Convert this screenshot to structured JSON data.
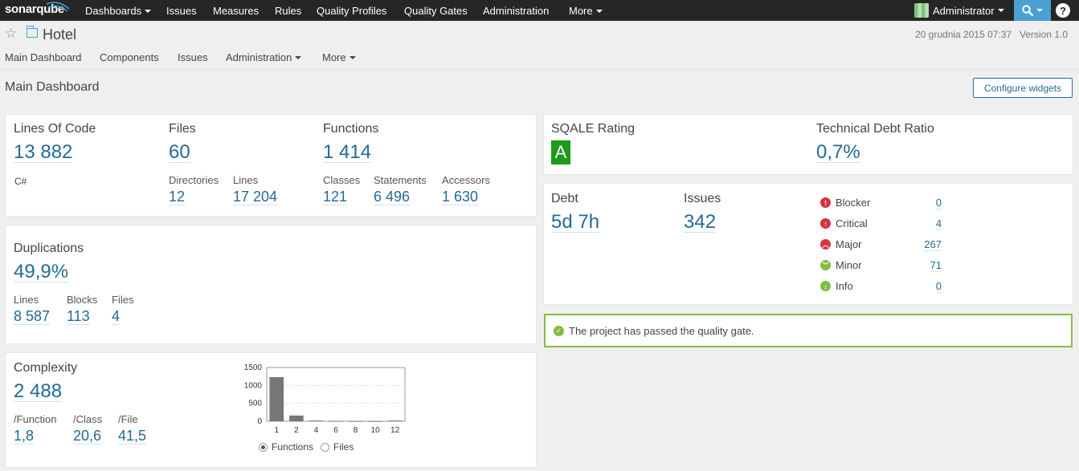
{
  "topnav": {
    "logo_text": "sonarqube",
    "items": [
      "Dashboards",
      "Issues",
      "Measures",
      "Rules",
      "Quality Profiles",
      "Quality Gates",
      "Administration",
      "More"
    ],
    "user": "Administrator",
    "help": "?"
  },
  "project": {
    "name": "Hotel",
    "date": "20 grudnia 2015 07:37",
    "version": "Version 1.0"
  },
  "subnav": [
    "Main Dashboard",
    "Components",
    "Issues",
    "Administration",
    "More"
  ],
  "page": {
    "title": "Main Dashboard",
    "configure_label": "Configure widgets"
  },
  "size_widget": {
    "loc_label": "Lines Of Code",
    "loc": "13 882",
    "language": "C#",
    "files_label": "Files",
    "files": "60",
    "functions_label": "Functions",
    "functions": "1 414",
    "directories_label": "Directories",
    "directories": "12",
    "lines_label": "Lines",
    "lines": "17 204",
    "classes_label": "Classes",
    "classes": "121",
    "statements_label": "Statements",
    "statements": "6 496",
    "accessors_label": "Accessors",
    "accessors": "1 630"
  },
  "duplications": {
    "label": "Duplications",
    "value": "49,9%",
    "lines_label": "Lines",
    "lines": "8 587",
    "blocks_label": "Blocks",
    "blocks": "113",
    "files_label": "Files",
    "files": "4"
  },
  "complexity": {
    "label": "Complexity",
    "value": "2 488",
    "per_function_label": "/Function",
    "per_function": "1,8",
    "per_class_label": "/Class",
    "per_class": "20,6",
    "per_file_label": "/File",
    "per_file": "41,5",
    "radio_functions": "Functions",
    "radio_files": "Files"
  },
  "chart_data": {
    "type": "bar",
    "categories": [
      "1",
      "2",
      "4",
      "6",
      "8",
      "10",
      "12"
    ],
    "values": [
      1230,
      160,
      20,
      5,
      3,
      2,
      20
    ],
    "ylim": [
      0,
      1500
    ],
    "yticks": [
      "1500",
      "1000",
      "500",
      "0"
    ],
    "grid": true,
    "bar_color": "#777777"
  },
  "sqale": {
    "rating_label": "SQALE Rating",
    "rating": "A",
    "rating_color": "#1b9a1b",
    "ratio_label": "Technical Debt Ratio",
    "ratio": "0,7%"
  },
  "issues_widget": {
    "debt_label": "Debt",
    "debt": "5d 7h",
    "issues_label": "Issues",
    "issues": "342",
    "severities": [
      {
        "name": "Blocker",
        "count": "0",
        "icon": "blocker-icon",
        "color": "#d4333f"
      },
      {
        "name": "Critical",
        "count": "4",
        "icon": "critical-icon",
        "color": "#d4333f"
      },
      {
        "name": "Major",
        "count": "267",
        "icon": "major-icon",
        "color": "#d4333f"
      },
      {
        "name": "Minor",
        "count": "71",
        "icon": "minor-icon",
        "color": "#85bb43"
      },
      {
        "name": "Info",
        "count": "0",
        "icon": "info-icon",
        "color": "#85bb43"
      }
    ]
  },
  "quality_gate": {
    "message": "The project has passed the quality gate.",
    "color": "#85bb43"
  }
}
